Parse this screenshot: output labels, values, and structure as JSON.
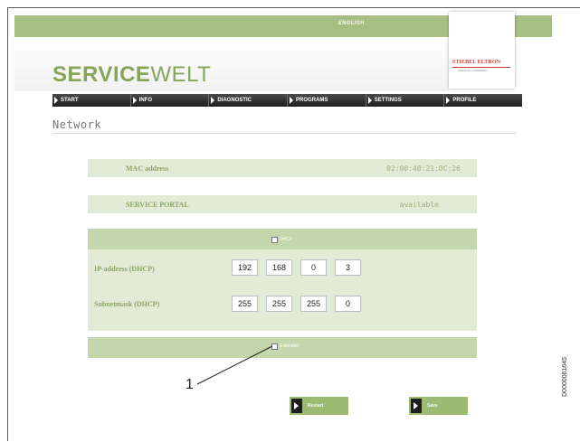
{
  "header": {
    "language": "ENGLISH",
    "brand_bold": "SERVICE",
    "brand_light": "WELT",
    "logo_text": "STIEBEL ELTRON",
    "logo_subtext": "Technik zum Wohlfühlen"
  },
  "nav": {
    "items": [
      "START",
      "INFO",
      "DIAGNOSTIC",
      "PROGRAMS",
      "SETTINGS",
      "PROFILE"
    ]
  },
  "page": {
    "title": "Network"
  },
  "network": {
    "mac_label": "MAC address",
    "mac_value": "02:00:40:21:DC:26",
    "portal_label": "SERVICE PORTAL",
    "portal_value": "available",
    "dhcp_label": "DHCP",
    "ip_label": "IP-address (DHCP)",
    "ip": [
      "192",
      "168",
      "0",
      "3"
    ],
    "subnet_label": "Subnetmask (DHCP)",
    "subnet": [
      "255",
      "255",
      "255",
      "0"
    ],
    "extended_label": "Extended"
  },
  "buttons": {
    "restart": "Restart",
    "save": "Save"
  },
  "annotation": {
    "callout": "1",
    "side_code": "D0000061645"
  }
}
